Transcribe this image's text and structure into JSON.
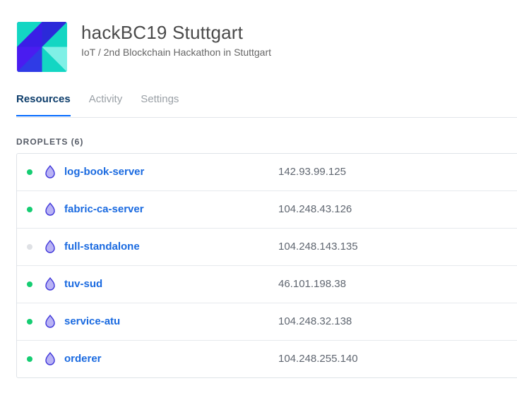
{
  "project": {
    "title": "hackBC19 Stuttgart",
    "subtitle": "IoT / 2nd Blockchain Hackathon in Stuttgart",
    "logo_icon": "pencil-edit-icon"
  },
  "tabs": [
    {
      "label": "Resources",
      "active": true
    },
    {
      "label": "Activity",
      "active": false
    },
    {
      "label": "Settings",
      "active": false
    }
  ],
  "droplets": {
    "heading": "DROPLETS (6)",
    "items": [
      {
        "name": "log-book-server",
        "ip": "142.93.99.125",
        "status": "on"
      },
      {
        "name": "fabric-ca-server",
        "ip": "104.248.43.126",
        "status": "on"
      },
      {
        "name": "full-standalone",
        "ip": "104.248.143.135",
        "status": "off"
      },
      {
        "name": "tuv-sud",
        "ip": "46.101.198.38",
        "status": "on"
      },
      {
        "name": "service-atu",
        "ip": "104.248.32.138",
        "status": "on"
      },
      {
        "name": "orderer",
        "ip": "104.248.255.140",
        "status": "on"
      }
    ]
  },
  "colors": {
    "status_on": "#15cd72",
    "status_off": "#dfe1e5",
    "link": "#1a6ae0",
    "tab_active": "#0d3d6b",
    "tab_underline": "#0069ff",
    "droplet_icon_fill": "#b9b3f5",
    "droplet_icon_stroke": "#3f36d9"
  }
}
